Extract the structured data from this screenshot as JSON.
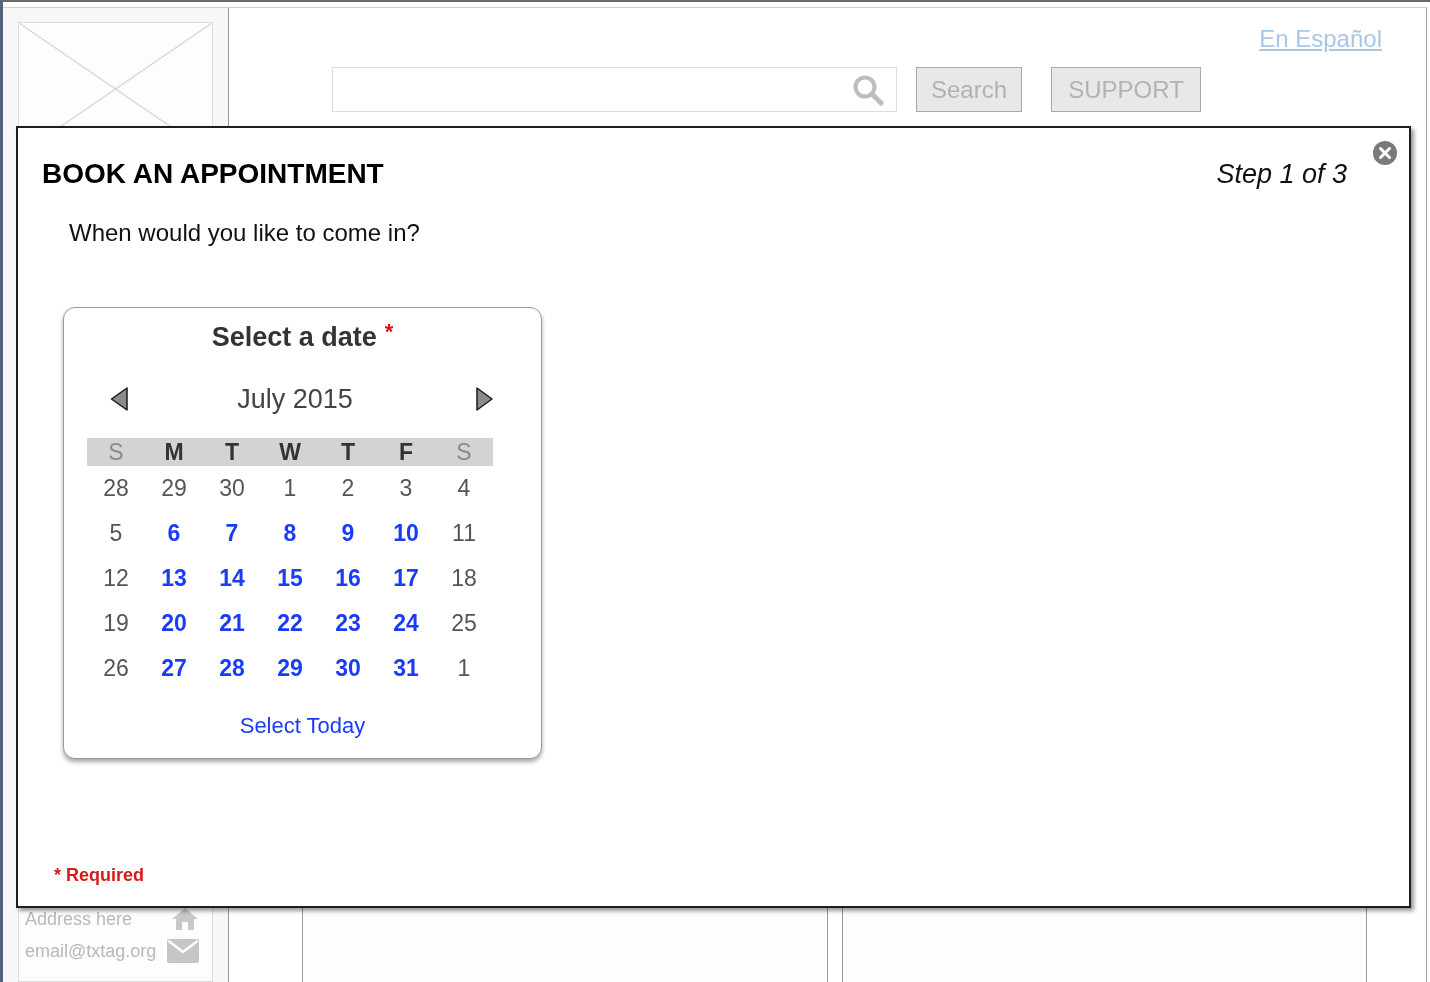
{
  "header": {
    "language_link": "En Español",
    "buttons": [
      "Search",
      "SUPPORT"
    ]
  },
  "sidebar": {
    "contact": [
      {
        "kind": "address",
        "text": "Address here"
      },
      {
        "kind": "email",
        "text": "email@txtag.org"
      }
    ]
  },
  "dialog": {
    "title": "BOOK AN APPOINTMENT",
    "step": "Step 1 of 3",
    "question": "When would you like to come in?",
    "calendar": {
      "title": "Select a date",
      "required_mark": "*",
      "month": "July 2015",
      "weekdays": [
        {
          "label": "S",
          "kind": "weekend"
        },
        {
          "label": "M",
          "kind": "weekday"
        },
        {
          "label": "T",
          "kind": "weekday"
        },
        {
          "label": "W",
          "kind": "weekday"
        },
        {
          "label": "T",
          "kind": "weekday"
        },
        {
          "label": "F",
          "kind": "weekday"
        },
        {
          "label": "S",
          "kind": "weekend"
        }
      ],
      "weeks": [
        [
          {
            "day": "28",
            "available": false
          },
          {
            "day": "29",
            "available": false
          },
          {
            "day": "30",
            "available": false
          },
          {
            "day": "1",
            "available": false
          },
          {
            "day": "2",
            "available": false
          },
          {
            "day": "3",
            "available": false
          },
          {
            "day": "4",
            "available": false
          }
        ],
        [
          {
            "day": "5",
            "available": false
          },
          {
            "day": "6",
            "available": true
          },
          {
            "day": "7",
            "available": true
          },
          {
            "day": "8",
            "available": true
          },
          {
            "day": "9",
            "available": true
          },
          {
            "day": "10",
            "available": true
          },
          {
            "day": "11",
            "available": false
          }
        ],
        [
          {
            "day": "12",
            "available": false
          },
          {
            "day": "13",
            "available": true
          },
          {
            "day": "14",
            "available": true
          },
          {
            "day": "15",
            "available": true
          },
          {
            "day": "16",
            "available": true
          },
          {
            "day": "17",
            "available": true
          },
          {
            "day": "18",
            "available": false
          }
        ],
        [
          {
            "day": "19",
            "available": false
          },
          {
            "day": "20",
            "available": true
          },
          {
            "day": "21",
            "available": true
          },
          {
            "day": "22",
            "available": true
          },
          {
            "day": "23",
            "available": true
          },
          {
            "day": "24",
            "available": true
          },
          {
            "day": "25",
            "available": false
          }
        ],
        [
          {
            "day": "26",
            "available": false
          },
          {
            "day": "27",
            "available": true
          },
          {
            "day": "28",
            "available": true
          },
          {
            "day": "29",
            "available": true
          },
          {
            "day": "30",
            "available": true
          },
          {
            "day": "31",
            "available": true
          },
          {
            "day": "1",
            "available": false
          }
        ]
      ],
      "select_today": "Select Today"
    },
    "required_note": "* Required"
  }
}
